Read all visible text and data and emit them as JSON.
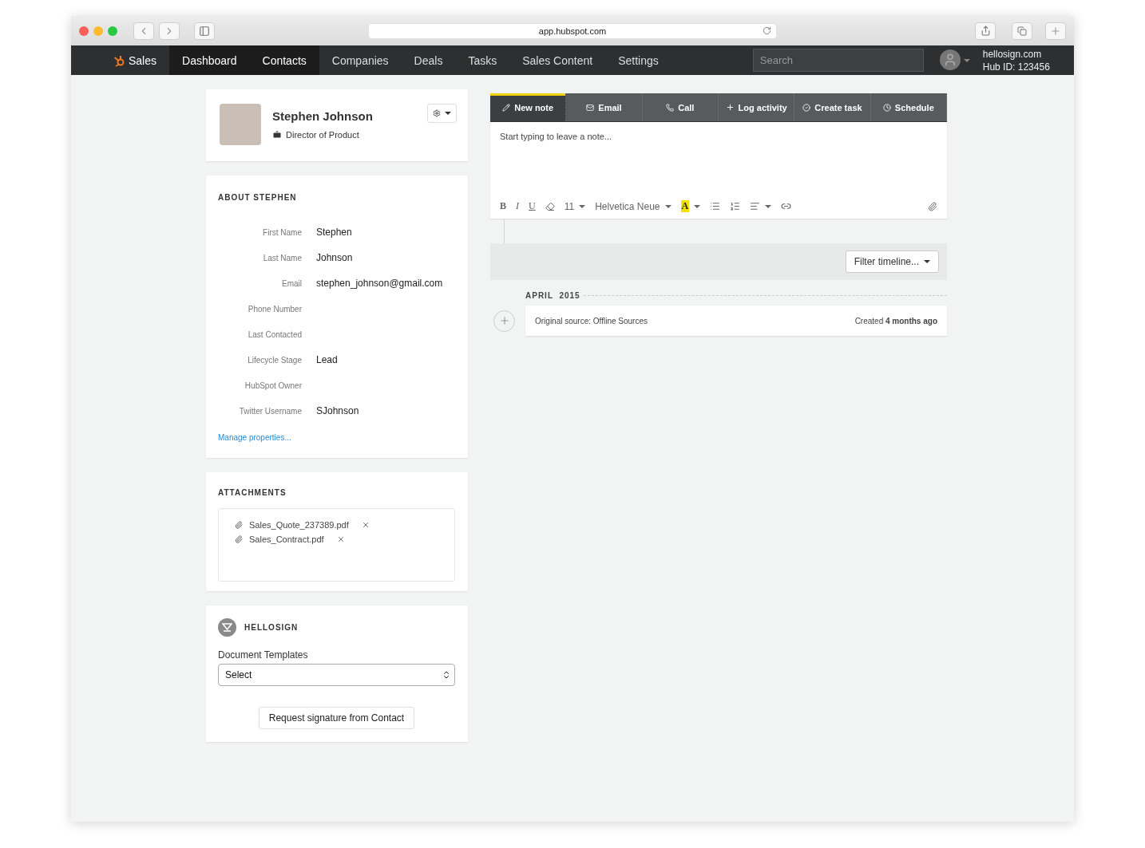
{
  "browser": {
    "url": "app.hubspot.com"
  },
  "nav": {
    "brand": "Sales",
    "items": [
      {
        "label": "Dashboard",
        "selected": true
      },
      {
        "label": "Contacts",
        "selected": true
      },
      {
        "label": "Companies",
        "selected": false
      },
      {
        "label": "Deals",
        "selected": false
      },
      {
        "label": "Tasks",
        "selected": false
      },
      {
        "label": "Sales Content",
        "selected": false
      },
      {
        "label": "Settings",
        "selected": false
      }
    ],
    "search": {
      "placeholder": "Search"
    },
    "account": "hellosign.com",
    "hub_id": "Hub ID: 123456"
  },
  "profile": {
    "name": "Stephen Johnson",
    "title": "Director of Product"
  },
  "about": {
    "heading": "ABOUT STEPHEN",
    "properties": [
      {
        "label": "First Name",
        "value": "Stephen"
      },
      {
        "label": "Last Name",
        "value": "Johnson"
      },
      {
        "label": "Email",
        "value": "stephen_johnson@gmail.com"
      },
      {
        "label": "Phone Number"
      },
      {
        "label": "Last Contacted"
      },
      {
        "label": "Lifecycle Stage",
        "value": "Lead"
      },
      {
        "label": "HubSpot Owner"
      },
      {
        "label": "Twitter Username",
        "value": "SJohnson"
      }
    ],
    "link": "Manage properties..."
  },
  "attachments": {
    "heading": "ATTACHMENTS",
    "files": [
      "Sales_Quote_237389.pdf",
      "Sales_Contract.pdf"
    ]
  },
  "hellosign": {
    "heading": "HELLOSIGN",
    "field_label": "Document Templates",
    "select_value": "Select",
    "button": "Request signature from Contact"
  },
  "composer": {
    "tabs": [
      {
        "label": "New note",
        "kind": "note",
        "selected": true
      },
      {
        "label": "Email",
        "kind": "email",
        "selected": false
      },
      {
        "label": "Call",
        "kind": "call",
        "selected": false
      },
      {
        "label": "Log activity",
        "kind": "log",
        "selected": false
      },
      {
        "label": "Create task",
        "kind": "task",
        "selected": false
      },
      {
        "label": "Schedule",
        "kind": "schedule",
        "selected": false
      }
    ],
    "placeholder": "Start typing to leave a note...",
    "toolbar": {
      "bold": "B",
      "italic": "I",
      "underline": "U",
      "font_size": "11",
      "font": "Helvetica Neue",
      "highlight_letter": "A"
    }
  },
  "timeline": {
    "filter": "Filter timeline...",
    "month": "APRIL  2015",
    "entries": [
      {
        "text": "Original source: Offline Sources",
        "meta": "Created **4 months ago**"
      }
    ]
  }
}
